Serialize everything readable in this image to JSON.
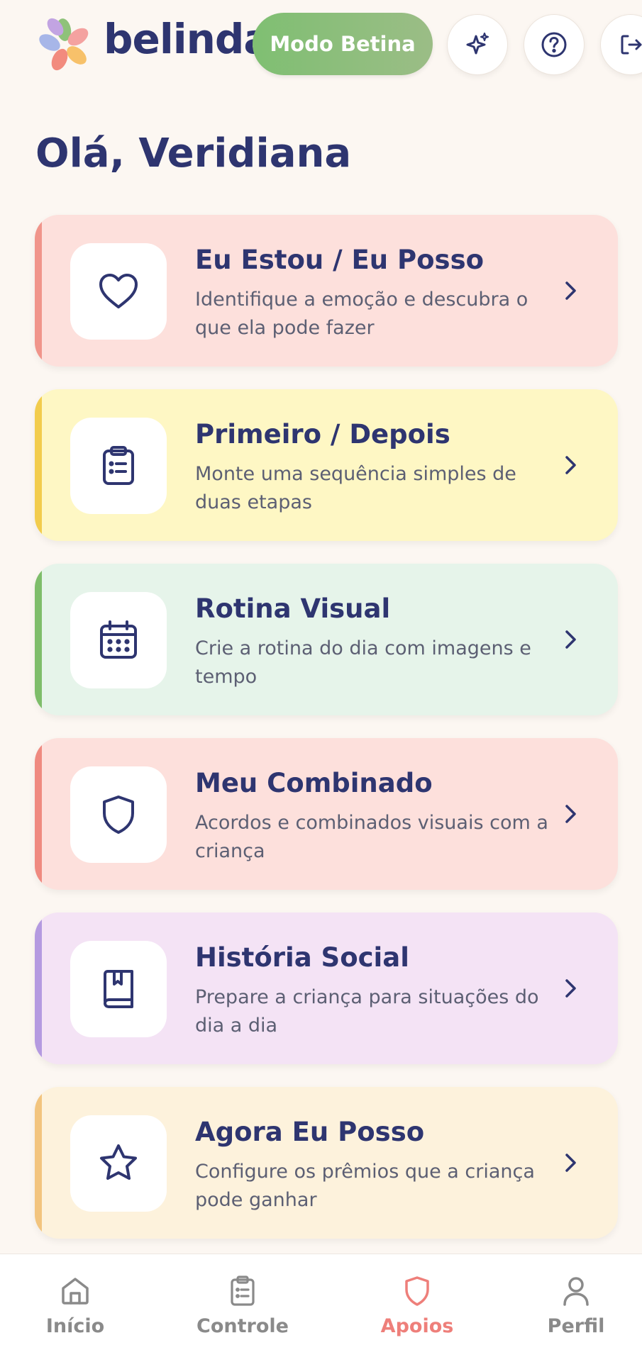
{
  "header": {
    "brand": "belinda",
    "mode_button": "Modo Betina",
    "icons": [
      "sparkle-icon",
      "help-icon",
      "logout-icon"
    ]
  },
  "greeting": "Olá, Veridiana",
  "cards": [
    {
      "title": "Eu Estou / Eu Posso",
      "description": "Identifique a emoção e descubra o que ela pode fazer",
      "icon": "heart-icon",
      "bg": "#fde0dc",
      "accent": "#f0958b"
    },
    {
      "title": "Primeiro / Depois",
      "description": "Monte uma sequência simples de duas etapas",
      "icon": "clipboard-icon",
      "bg": "#fef7c4",
      "accent": "#f2cc4d"
    },
    {
      "title": "Rotina Visual",
      "description": "Crie a rotina do dia com imagens e tempo",
      "icon": "calendar-icon",
      "bg": "#e6f4ea",
      "accent": "#7ebd6a"
    },
    {
      "title": "Meu Combinado",
      "description": "Acordos e combinados visuais com a criança",
      "icon": "shield-icon",
      "bg": "#fde0dc",
      "accent": "#ef8a80"
    },
    {
      "title": "História Social",
      "description": "Prepare a criança para situações do dia a dia",
      "icon": "book-icon",
      "bg": "#f4e3f5",
      "accent": "#b49ae0"
    },
    {
      "title": "Agora Eu Posso",
      "description": "Configure os prêmios que a criança pode ganhar",
      "icon": "star-icon",
      "bg": "#fdf2dc",
      "accent": "#f2c47e"
    }
  ],
  "nav": [
    {
      "label": "Início",
      "icon": "home-icon",
      "active": false
    },
    {
      "label": "Controle",
      "icon": "clipboard-icon",
      "active": false
    },
    {
      "label": "Apoios",
      "icon": "shield-icon",
      "active": true
    },
    {
      "label": "Perfil",
      "icon": "user-icon",
      "active": false
    }
  ],
  "colors": {
    "brand_navy": "#2e3570",
    "mode_green": "#86bb78",
    "active_coral": "#ee7f7a",
    "background": "#fcf7f2"
  }
}
